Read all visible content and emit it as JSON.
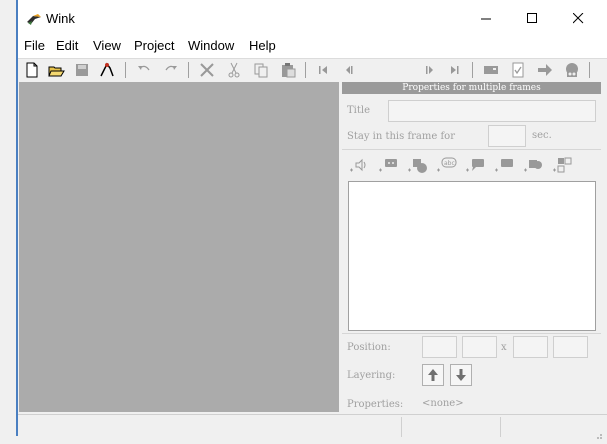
{
  "window": {
    "title": "Wink"
  },
  "menu": {
    "items": [
      "File",
      "Edit",
      "View",
      "Project",
      "Window",
      "Help"
    ]
  },
  "toolbar": {
    "buttons": [
      "new-icon",
      "open-icon",
      "save-icon",
      "render-icon",
      "undo-icon",
      "redo-icon",
      "delete-icon",
      "cut-icon",
      "copy-icon",
      "paste-icon",
      "first-frame-icon",
      "prev-frame-icon",
      "next-frame-icon",
      "last-frame-icon",
      "frame-props-icon",
      "check-icon",
      "arrow-right-icon",
      "preview-icon"
    ]
  },
  "panel": {
    "header": "Properties for multiple frames",
    "title_label": "Title",
    "stay_label": "Stay in this frame for",
    "stay_unit": "sec.",
    "position_label": "Position:",
    "position_x_sep": "x",
    "layering_label": "Layering:",
    "properties_label": "Properties:",
    "properties_value": "<none>"
  }
}
